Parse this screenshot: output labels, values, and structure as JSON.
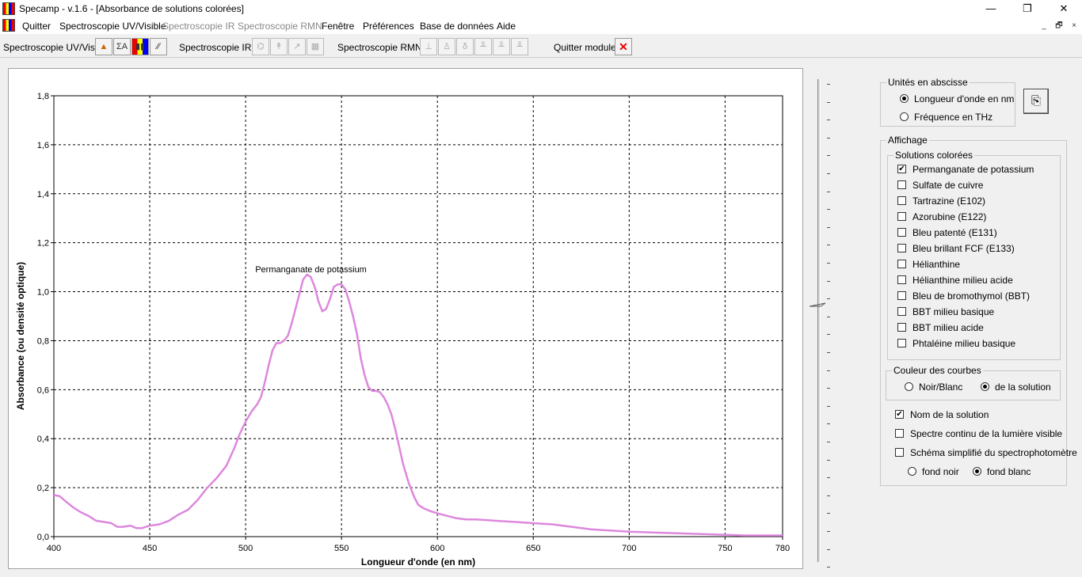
{
  "window": {
    "title": "Specamp - v.1.6 - [Absorbance de solutions colorées]",
    "controls": {
      "minimize": "—",
      "maximize": "❐",
      "close": "✕"
    },
    "mdi_controls": {
      "minimize": "_",
      "restore": "🗗",
      "close": "×"
    }
  },
  "menu": [
    "Quitter",
    "Spectroscopie UV/Visible",
    "Spectroscopie IR",
    "Spectroscopie RMN",
    "Fenêtre",
    "Préférences",
    "Base de données",
    "Aide"
  ],
  "menu_disabled": [
    "Spectroscopie IR",
    "Spectroscopie RMN"
  ],
  "toolbar": {
    "uv_label": "Spectroscopie UV/Vis :",
    "uv_buttons": [
      "▲",
      "ΣA",
      "▮▮",
      "∕∕"
    ],
    "ir_label": "Spectroscopie IR :",
    "ir_buttons": [
      "⌬",
      "↟",
      "↗",
      "▦"
    ],
    "rmn_label": "Spectroscopie RMN :",
    "rmn_buttons": [
      "⊥",
      "♙",
      "δ",
      "╨",
      "╨",
      "╨"
    ],
    "quit_label": "Quitter module :",
    "quit_button": "✕"
  },
  "chart_data": {
    "type": "line",
    "title": "",
    "xlabel": "Longueur d'onde (en nm)",
    "ylabel": "Absorbance (ou densité optique)",
    "xlim": [
      400,
      780
    ],
    "ylim": [
      0,
      1.8
    ],
    "xticks": [
      "400",
      "450",
      "500",
      "550",
      "600",
      "650",
      "700",
      "750",
      "780"
    ],
    "xtick_values": [
      400,
      450,
      500,
      550,
      600,
      650,
      700,
      750,
      780
    ],
    "yticks": [
      "0,0",
      "0,2",
      "0,4",
      "0,6",
      "0,8",
      "1,0",
      "1,2",
      "1,4",
      "1,6",
      "1,8"
    ],
    "ytick_values": [
      0,
      0.2,
      0.4,
      0.6,
      0.8,
      1.0,
      1.2,
      1.4,
      1.6,
      1.8
    ],
    "grid": true,
    "annotation": "Permanganate de potassium",
    "series": [
      {
        "name": "Permanganate de potassium",
        "color": "#dd88dd",
        "x": [
          400,
          403,
          406,
          410,
          414,
          418,
          422,
          426,
          430,
          433,
          436,
          440,
          443,
          446,
          450,
          455,
          460,
          465,
          470,
          475,
          480,
          485,
          490,
          494,
          497,
          500,
          503,
          506,
          508,
          510,
          512,
          514,
          516,
          518,
          520,
          522,
          524,
          526,
          528,
          530,
          532,
          534,
          536,
          538,
          540,
          542,
          544,
          546,
          548,
          550,
          552,
          554,
          556,
          558,
          560,
          562,
          564,
          566,
          568,
          570,
          572,
          574,
          576,
          578,
          580,
          582,
          585,
          588,
          590,
          593,
          596,
          600,
          605,
          610,
          615,
          620,
          625,
          630,
          640,
          650,
          660,
          670,
          680,
          690,
          700,
          720,
          740,
          760,
          780
        ],
        "y": [
          0.17,
          0.165,
          0.145,
          0.12,
          0.1,
          0.085,
          0.065,
          0.06,
          0.055,
          0.04,
          0.04,
          0.045,
          0.035,
          0.035,
          0.045,
          0.05,
          0.065,
          0.09,
          0.11,
          0.15,
          0.2,
          0.24,
          0.29,
          0.36,
          0.42,
          0.47,
          0.51,
          0.54,
          0.57,
          0.63,
          0.7,
          0.76,
          0.79,
          0.79,
          0.8,
          0.82,
          0.87,
          0.93,
          0.99,
          1.05,
          1.07,
          1.06,
          1.02,
          0.96,
          0.92,
          0.93,
          0.97,
          1.02,
          1.03,
          1.03,
          1.01,
          0.96,
          0.9,
          0.83,
          0.73,
          0.66,
          0.61,
          0.595,
          0.595,
          0.59,
          0.57,
          0.54,
          0.5,
          0.44,
          0.37,
          0.3,
          0.22,
          0.16,
          0.13,
          0.115,
          0.105,
          0.095,
          0.085,
          0.075,
          0.07,
          0.07,
          0.068,
          0.065,
          0.06,
          0.055,
          0.05,
          0.04,
          0.03,
          0.025,
          0.02,
          0.015,
          0.01,
          0.005,
          0.005
        ]
      }
    ]
  },
  "units_group": {
    "legend": "Unités en abscisse",
    "options": [
      {
        "label": "Longueur d'onde en nm",
        "selected": true
      },
      {
        "label": "Fréquence en THz",
        "selected": false
      }
    ],
    "copy_button": "⎘"
  },
  "display_group": {
    "legend": "Affichage",
    "solutions_legend": "Solutions colorées",
    "solutions": [
      {
        "label": "Permanganate de potassium",
        "checked": true
      },
      {
        "label": "Sulfate de cuivre",
        "checked": false
      },
      {
        "label": "Tartrazine (E102)",
        "checked": false
      },
      {
        "label": "Azorubine (E122)",
        "checked": false
      },
      {
        "label": "Bleu patenté (E131)",
        "checked": false
      },
      {
        "label": "Bleu brillant FCF (E133)",
        "checked": false
      },
      {
        "label": "Hélianthine",
        "checked": false
      },
      {
        "label": "Hélianthine milieu acide",
        "checked": false
      },
      {
        "label": "Bleu de bromothymol (BBT)",
        "checked": false
      },
      {
        "label": "BBT milieu basique",
        "checked": false
      },
      {
        "label": "BBT milieu acide",
        "checked": false
      },
      {
        "label": "Phtaléine milieu basique",
        "checked": false
      }
    ],
    "curve_color_legend": "Couleur des courbes",
    "curve_colors": [
      {
        "label": "Noir/Blanc",
        "selected": false
      },
      {
        "label": "de la solution",
        "selected": true
      }
    ],
    "extras": [
      {
        "label": "Nom de la solution",
        "checked": true
      },
      {
        "label": "Spectre continu de la lumière visible",
        "checked": false
      },
      {
        "label": "Schéma simplifié du spectrophotomètre",
        "checked": false
      }
    ],
    "backgrounds": [
      {
        "label": "fond noir",
        "selected": false
      },
      {
        "label": "fond blanc",
        "selected": true
      }
    ]
  },
  "check_mark": "✔"
}
